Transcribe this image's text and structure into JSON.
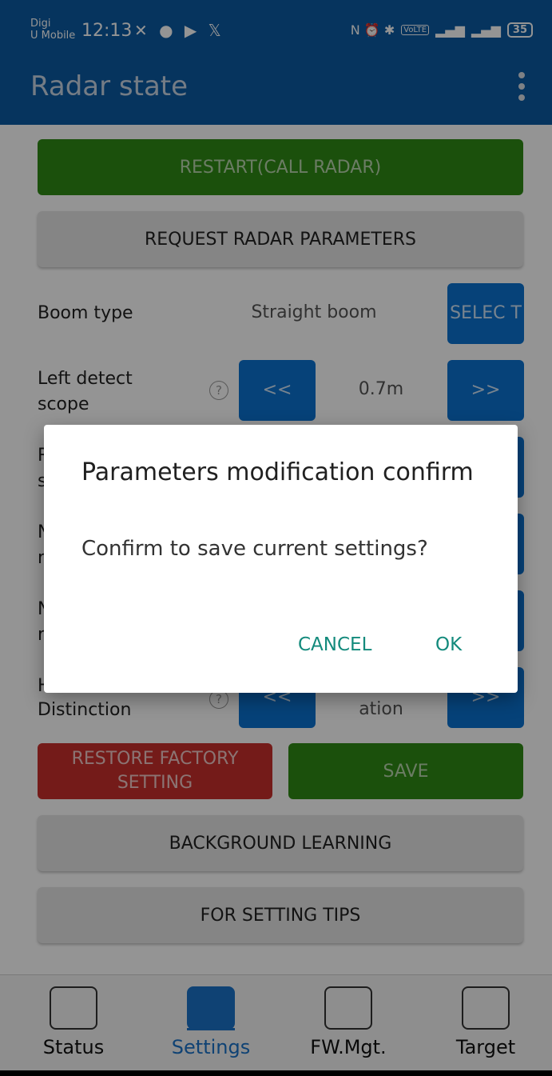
{
  "status_bar": {
    "carrier_line1": "Digi",
    "carrier_line2": "U Mobile",
    "time": "12:13",
    "left_icons": "✕ ● ▶ 𝕏",
    "right_icons": "N ⏰ ✱",
    "volte": "VoLTE",
    "battery": "35"
  },
  "app_bar": {
    "title": "Radar state"
  },
  "content": {
    "restart_label": "RESTART(CALL RADAR)",
    "request_label": "REQUEST RADAR PARAMETERS",
    "boom_type_label": "Boom type",
    "boom_type_value": "Straight boom",
    "select_label": "SELEC T",
    "left_detect_label": "Left detect scope",
    "left_detect_value": "0.7m",
    "prev_label": "<<",
    "next_label": ">>",
    "partial_label_1": "R",
    "partial_label_1b": "s",
    "partial_label_2": "N",
    "partial_label_2b": "r",
    "partial_label_3": "N",
    "partial_label_3b": "r",
    "partial_label_4": "H",
    "distinction_label": "Distinction",
    "distinction_value": "ation",
    "help_glyph": "?",
    "restore_label": "RESTORE FACTORY SETTING",
    "save_label": "SAVE",
    "background_learning_label": "BACKGROUND LEARNING",
    "setting_tips_label": "FOR SETTING TIPS"
  },
  "bottom_nav": {
    "items": [
      {
        "label": "Status",
        "icon": "status-icon"
      },
      {
        "label": "Settings",
        "icon": "settings-icon"
      },
      {
        "label": "FW.Mgt.",
        "icon": "fw-mgt-icon"
      },
      {
        "label": "Target",
        "icon": "target-icon"
      }
    ],
    "active_index": 1
  },
  "dialog": {
    "title": "Parameters modification confirm",
    "message": "Confirm to save current settings?",
    "cancel_label": "CANCEL",
    "ok_label": "OK"
  },
  "colors": {
    "primary": "#0b5aa2",
    "green": "#2f8a16",
    "blue_button": "#0b72d0",
    "red": "#c9302c",
    "dialog_accent": "#138a7c"
  }
}
